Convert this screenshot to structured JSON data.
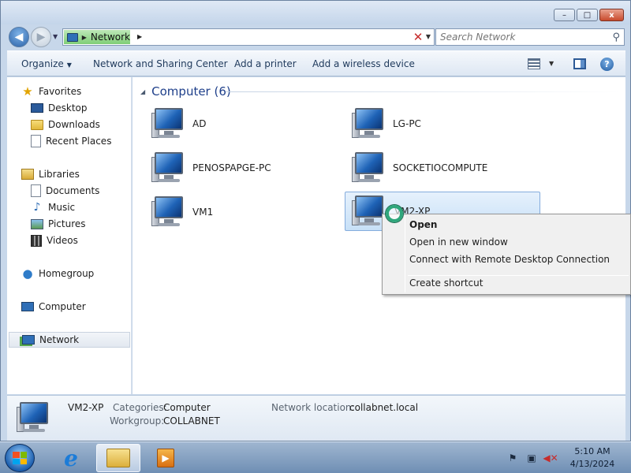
{
  "window": {
    "controls": {
      "minimize": "–",
      "maximize": "□",
      "close": "x"
    }
  },
  "address": {
    "crumb": "Network",
    "search_placeholder": "Search Network"
  },
  "toolbar": {
    "organize": "Organize",
    "network_sharing": "Network and Sharing Center",
    "add_printer": "Add a printer",
    "add_wireless": "Add a wireless device"
  },
  "sidebar": {
    "favorites": "Favorites",
    "desktop": "Desktop",
    "downloads": "Downloads",
    "recent_places": "Recent Places",
    "libraries": "Libraries",
    "documents": "Documents",
    "music": "Music",
    "pictures": "Pictures",
    "videos": "Videos",
    "homegroup": "Homegroup",
    "computer": "Computer",
    "network": "Network"
  },
  "content": {
    "group_title": "Computer (6)",
    "computers": [
      "AD",
      "LG-PC",
      "PENOSPAPGE-PC",
      "SOCKETIOCOMPUTE",
      "VM1",
      "VM2-XP"
    ],
    "selected": "VM2-XP"
  },
  "context_menu": {
    "open": "Open",
    "open_new_window": "Open in new window",
    "remote_desktop": "Connect with Remote Desktop Connection",
    "create_shortcut": "Create shortcut"
  },
  "details": {
    "name": "VM2-XP",
    "categories_label": "Categories:",
    "categories_value": "Computer",
    "workgroup_label": "Workgroup:",
    "workgroup_value": "COLLABNET",
    "location_label": "Network location:",
    "location_value": "collabnet.local"
  },
  "taskbar": {
    "time": "5:10 AM",
    "date": "4/13/2024"
  }
}
